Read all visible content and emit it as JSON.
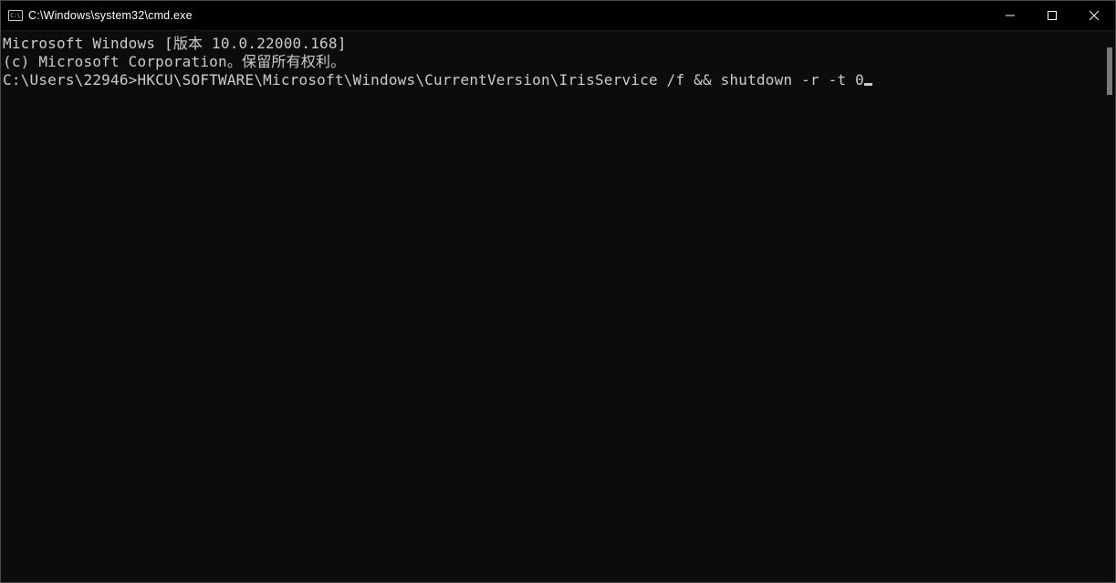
{
  "window": {
    "title": "C:\\Windows\\system32\\cmd.exe"
  },
  "terminal": {
    "line1": "Microsoft Windows [版本 10.0.22000.168]",
    "line2": "(c) Microsoft Corporation。保留所有权利。",
    "blank": "",
    "prompt": "C:\\Users\\22946>",
    "command": "HKCU\\SOFTWARE\\Microsoft\\Windows\\CurrentVersion\\IrisService /f && shutdown -r -t 0"
  }
}
